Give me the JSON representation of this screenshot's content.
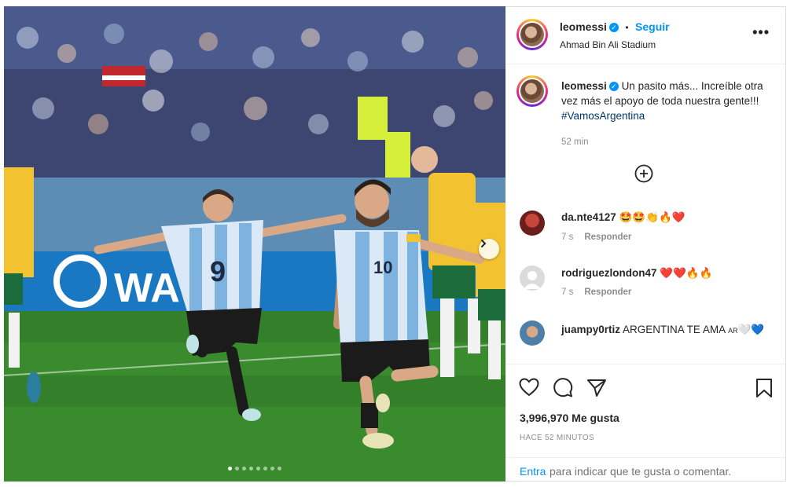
{
  "post": {
    "username": "leomessi",
    "follow_label": "Seguir",
    "separator": "•",
    "location": "Ahmad Bin Ali Stadium",
    "more_label": "•••"
  },
  "caption": {
    "username": "leomessi",
    "text": "Un pasito más... Increíble otra vez más el apoyo de toda nuestra gente!!! ",
    "hashtag": "#VamosArgentina",
    "time": "52 min"
  },
  "comments": [
    {
      "username": "da.nte4127",
      "text": "🤩🤩👏🔥❤️",
      "time": "7 s",
      "reply_label": "Responder"
    },
    {
      "username": "rodriguezlondon47",
      "text": "❤️❤️🔥🔥",
      "time": "7 s",
      "reply_label": "Responder"
    },
    {
      "username": "juampy0rtiz",
      "text": "ARGENTINA TE AMA",
      "flag_text": "AR",
      "hearts": "🤍💙"
    }
  ],
  "stats": {
    "likes": "3,996,970 Me gusta",
    "time_ago": "HACE 52 MINUTOS"
  },
  "add_comment": {
    "login_link": "Entra",
    "rest_text": "para indicar que te gusta o comentar."
  },
  "photo": {
    "banner_text": "WA  DA",
    "jersey_left": "9",
    "jersey_right": "10",
    "carousel_count": 8,
    "carousel_active": 0
  },
  "icons": [
    "heart-icon",
    "comment-icon",
    "share-icon",
    "bookmark-icon",
    "plus-circle-icon",
    "chevron-right-icon",
    "verified-icon"
  ]
}
